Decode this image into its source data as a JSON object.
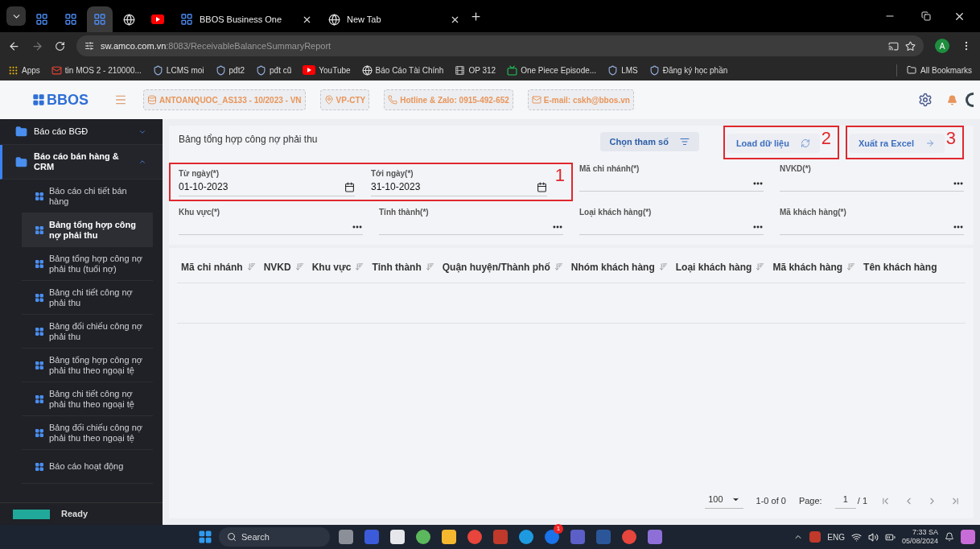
{
  "browser": {
    "tabs": [
      {
        "kind": "grid",
        "selected": false
      },
      {
        "kind": "grid",
        "selected": false
      },
      {
        "kind": "grid",
        "selected": true
      },
      {
        "kind": "globe",
        "selected": false
      },
      {
        "kind": "youtube",
        "selected": false
      },
      {
        "kind": "grid",
        "title": "BBOS Business One",
        "selected": false
      },
      {
        "kind": "globe",
        "title": "New Tab",
        "selected": false
      }
    ],
    "url_host": "sw.amco.com.vn",
    "url_path": ":8083/ReceivableBalanceSummaryReport",
    "profile": "A",
    "bookmarks": [
      {
        "kind": "apps",
        "label": "Apps"
      },
      {
        "kind": "mail",
        "label": "tin MOS 2 - 210000..."
      },
      {
        "kind": "shield",
        "label": "LCMS moi"
      },
      {
        "kind": "shield",
        "label": "pđt2"
      },
      {
        "kind": "shield",
        "label": "pđt cũ"
      },
      {
        "kind": "youtube",
        "label": "YouTube"
      },
      {
        "kind": "globe",
        "label": "Báo Cáo Tài Chính"
      },
      {
        "kind": "film",
        "label": "OP 312"
      },
      {
        "kind": "tv",
        "label": "One Piece Episode..."
      },
      {
        "kind": "shield",
        "label": "LMS"
      },
      {
        "kind": "shield",
        "label": "Đăng ký học phần"
      }
    ],
    "all_bookmarks": "All Bookmarks"
  },
  "header": {
    "logo": "BBOS",
    "chips": [
      {
        "kind": "database",
        "text": "ANTOANQUOC_AS133 - 10/2023 - VN"
      },
      {
        "kind": "pin",
        "text": "VP-CTY"
      },
      {
        "kind": "phone",
        "text": "Hotline & Zalo: 0915-492-652"
      },
      {
        "kind": "mail",
        "text": "E-mail: cskh@bbos.vn"
      }
    ]
  },
  "sidebar": {
    "groups": [
      {
        "label": "Báo cáo BGĐ",
        "expanded": false,
        "selected": false
      },
      {
        "label": "Báo cáo bán hàng & CRM",
        "expanded": true,
        "selected": true,
        "children": [
          {
            "label": "Báo cáo chi tiết bán hàng",
            "selected": false
          },
          {
            "label": "Bảng tổng hợp công nợ phải thu",
            "selected": true
          },
          {
            "label": "Bảng tổng hợp công nợ phải thu (tuổi nợ)",
            "selected": false
          },
          {
            "label": "Bảng chi tiết công nợ phải thu",
            "selected": false
          },
          {
            "label": "Bảng đối chiếu công nợ phải thu",
            "selected": false
          },
          {
            "label": "Bảng tổng hợp công nợ phải thu theo ngoại tệ",
            "selected": false
          },
          {
            "label": "Bảng chi tiết công nợ phải thu theo ngoại tệ",
            "selected": false
          },
          {
            "label": "Bảng đối chiếu công nợ phải thu theo ngoại tệ",
            "selected": false
          },
          {
            "label": "Báo cáo hoạt động",
            "selected": false
          }
        ]
      }
    ],
    "status": "Ready"
  },
  "report": {
    "title": "Bảng tổng hợp công nợ phải thu",
    "buttons": [
      {
        "kind": "params",
        "label": "Chọn tham số"
      },
      {
        "kind": "load",
        "label": "Load dữ liệu",
        "annotation": "2"
      },
      {
        "kind": "export",
        "label": "Xuất ra Excel",
        "annotation": "3"
      }
    ],
    "date_annotation": "1",
    "fields": [
      {
        "kind": "date",
        "label": "Từ ngày(*)",
        "value": "01-10-2023"
      },
      {
        "kind": "date",
        "label": "Tới ngày(*)",
        "value": "31-10-2023"
      },
      {
        "kind": "picker",
        "label": "Mã chi nhánh(*)"
      },
      {
        "kind": "picker",
        "label": "NVKD(*)"
      },
      {
        "kind": "picker",
        "label": "Khu vực(*)"
      },
      {
        "kind": "picker",
        "label": "Tỉnh thành(*)"
      },
      {
        "kind": "picker",
        "label": "Loại khách hàng(*)"
      },
      {
        "kind": "picker",
        "label": "Mã khách hàng(*)"
      }
    ],
    "columns": [
      {
        "label": "Mã chi nhánh",
        "sortable": true
      },
      {
        "label": "NVKD",
        "sortable": true
      },
      {
        "label": "Khu vực",
        "sortable": true
      },
      {
        "label": "Tỉnh thành",
        "sortable": true
      },
      {
        "label": "Quận huyện/Thành phố",
        "sortable": true
      },
      {
        "label": "Nhóm khách hàng",
        "sortable": true
      },
      {
        "label": "Loại khách hàng",
        "sortable": true
      },
      {
        "label": "Mã khách hàng",
        "sortable": true
      },
      {
        "label": "Tên khách hàng",
        "sortable": false
      }
    ],
    "pagination": {
      "page_size": "100",
      "range": "1-0 of 0",
      "page_label": "Page:",
      "page": "1",
      "total": "/ 1"
    }
  },
  "taskbar": {
    "search": "Search",
    "badge": "1",
    "language": "ENG",
    "time": "7:33 SA",
    "date": "05/08/2024"
  }
}
